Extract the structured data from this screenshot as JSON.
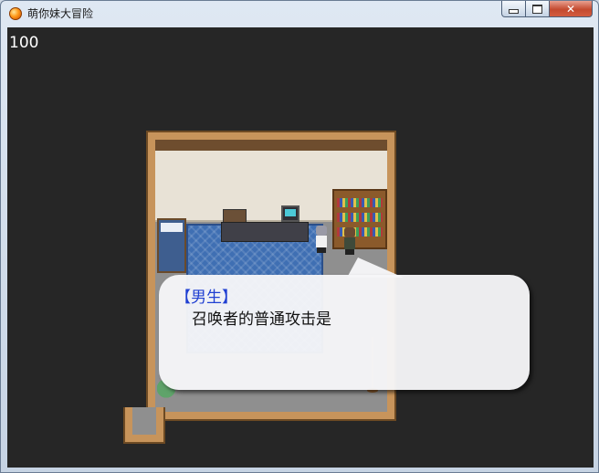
{
  "window": {
    "title": "萌你妹大冒险",
    "controls": {
      "minimize_icon": "minimize-icon",
      "maximize_icon": "maximize-icon",
      "close_label": "✕"
    }
  },
  "hud": {
    "counter": "100"
  },
  "dialog": {
    "speaker": "【男生】",
    "text": "召唤者的普通攻击是"
  },
  "colors": {
    "screen_bg": "#262626",
    "speaker_name": "#1f3fd2",
    "carpet": "#3f6fb3",
    "floor_wood": "#c7945b"
  }
}
